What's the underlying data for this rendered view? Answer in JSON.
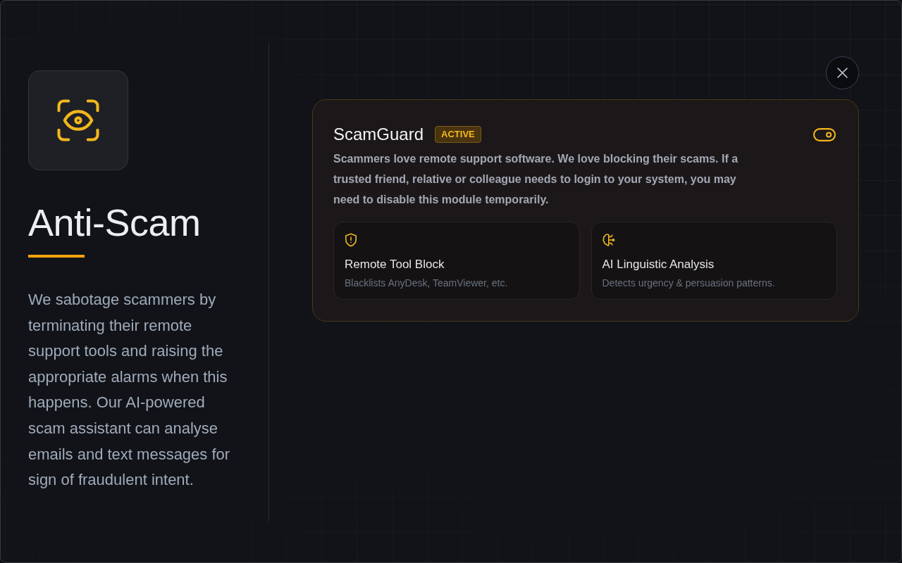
{
  "hero": {
    "title": "Anti-Scam",
    "description": "We sabotage scammers by terminating their remote support tools and raising the appropriate alarms when this happens. Our AI-powered scam assistant can analyse emails and text messages for sign of fraudulent intent."
  },
  "module": {
    "name": "ScamGuard",
    "badge": "ACTIVE",
    "enabled": true,
    "description": "Scammers love remote support software. We love blocking their scams. If a trusted friend, relative or colleague needs to login to your system, you may need to disable this module temporarily.",
    "features": [
      {
        "kind": "shield",
        "title": "Remote Tool Block",
        "subtitle": "Blacklists AnyDesk, TeamViewer, etc."
      },
      {
        "kind": "brain",
        "title": "AI Linguistic Analysis",
        "subtitle": "Detects urgency & persuasion patterns."
      }
    ]
  }
}
